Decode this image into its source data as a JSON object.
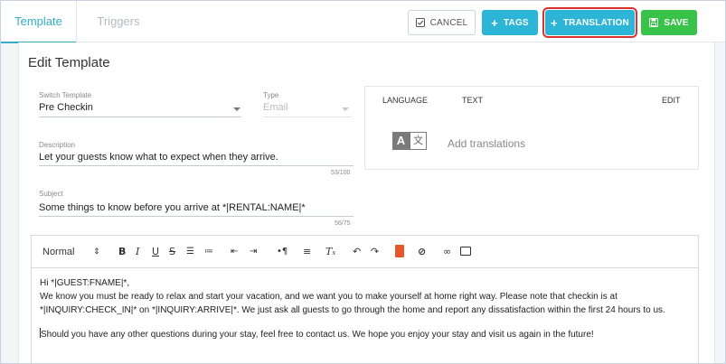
{
  "tabs": [
    {
      "label": "Template",
      "active": true
    },
    {
      "label": "Triggers",
      "active": false
    }
  ],
  "actions": {
    "cancel": "CANCEL",
    "tags": "TAGS",
    "translation": "TRANSLATION",
    "save": "SAVE"
  },
  "page_title": "Edit Template",
  "form": {
    "switch_template": {
      "label": "Switch Template",
      "value": "Pre Checkin"
    },
    "type": {
      "label": "Type",
      "value": "Email"
    },
    "description": {
      "label": "Description",
      "value": "Let your guests know what to expect when they arrive.",
      "counter": "53/100"
    },
    "subject": {
      "label": "Subject",
      "value": "Some things to know before you arrive at *|RENTAL:NAME|*",
      "counter": "56/75"
    }
  },
  "translations": {
    "headers": {
      "language": "LANGUAGE",
      "text": "TEXT",
      "edit": "EDIT"
    },
    "empty_text": "Add translations",
    "icon_latin": "A",
    "icon_cjk": "文"
  },
  "editor": {
    "format_label": "Normal",
    "body": [
      "Hi *|GUEST:FNAME|*,",
      "We know you must be ready to relax and start your vacation, and we want you to make yourself at home right way. Please note that checkin is at",
      "*|INQUIRY:CHECK_IN|* on *|INQUIRY:ARRIVE|*. We just ask all guests to go through the home and report any dissatisfaction within the first 24 hours to us.",
      "",
      "Should you have any other questions during your stay, feel free to contact us. We hope you enjoy your stay and visit us again in the future!"
    ]
  },
  "colors": {
    "accent": "#2cb5d6",
    "save": "#39c24a",
    "highlight": "#d9322f"
  }
}
